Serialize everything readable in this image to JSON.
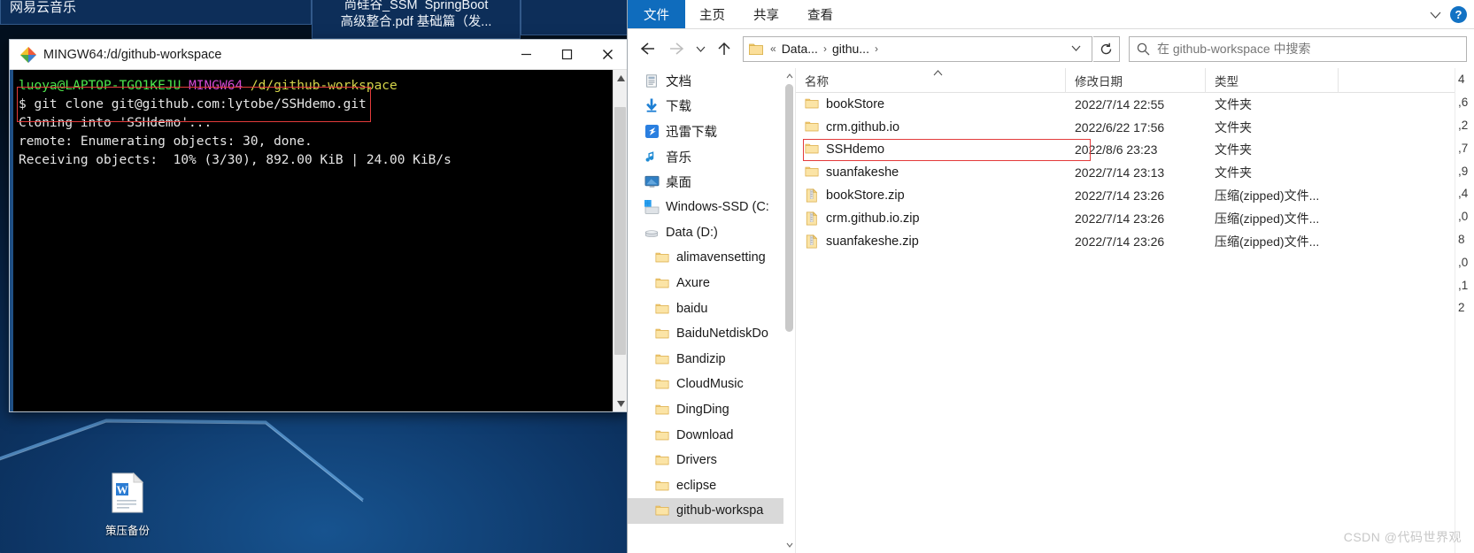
{
  "desktop": {
    "bg_windows": [
      {
        "name": "music-app-window",
        "title": "网易云音乐"
      },
      {
        "name": "pdf-reader-window",
        "title": "尚硅谷_SSM  SpringBoot\n高级整合.pdf 基础篇（发..."
      }
    ],
    "file_icon": {
      "label": "策压备份",
      "icon": "word-document-icon"
    }
  },
  "bash": {
    "title": "MINGW64:/d/github-workspace",
    "icon": "git-bash-icon",
    "minimize_label": "—",
    "maximize_label": "□",
    "close_label": "✕",
    "lines": [
      {
        "type": "prompt",
        "user": "luoya@LAPTOP-TGO1KEJU",
        "shell": "MINGW64",
        "path": "/d/github-workspace"
      },
      {
        "type": "command",
        "prefix": "$",
        "text": "git clone git@github.com:lytobe/SSHdemo.git"
      },
      {
        "type": "output",
        "text": "Cloning into 'SSHdemo'..."
      },
      {
        "type": "output",
        "text": "remote: Enumerating objects: 30, done."
      },
      {
        "type": "output",
        "text": "Receiving objects:  10% (3/30), 892.00 KiB | 24.00 KiB/s"
      }
    ],
    "highlight_color": "#e33b3b",
    "scroll_up": "▲",
    "scroll_down": "▼"
  },
  "explorer": {
    "tabs": [
      {
        "name": "tab-file",
        "label": "文件",
        "active": true
      },
      {
        "name": "tab-home",
        "label": "主页",
        "active": false
      },
      {
        "name": "tab-share",
        "label": "共享",
        "active": false
      },
      {
        "name": "tab-view",
        "label": "查看",
        "active": false
      }
    ],
    "ribbon_collapse_icon": "chevron-down-icon",
    "help_label": "?",
    "nav": {
      "back_icon": "arrow-left-icon",
      "forward_icon": "arrow-right-icon",
      "recent_icon": "chevron-down-icon",
      "up_icon": "arrow-up-icon",
      "refresh_icon": "refresh-icon",
      "breadcrumbs": [
        "«",
        "Data...",
        "githu..."
      ],
      "breadcrumb_dropdown_icon": "chevron-down-icon"
    },
    "search": {
      "icon": "search-icon",
      "placeholder": "在 github-workspace 中搜索",
      "value": ""
    },
    "sidebar": {
      "scroll_up": "∧",
      "scroll_down": "∨",
      "items": [
        {
          "label": "文档",
          "icon": "documents-icon",
          "indent": 1,
          "selected": false
        },
        {
          "label": "下载",
          "icon": "downloads-arrow-icon",
          "indent": 1,
          "selected": false
        },
        {
          "label": "迅雷下载",
          "icon": "thunder-download-icon",
          "indent": 1,
          "selected": false
        },
        {
          "label": "音乐",
          "icon": "music-note-icon",
          "indent": 1,
          "selected": false
        },
        {
          "label": "桌面",
          "icon": "desktop-monitor-icon",
          "indent": 1,
          "selected": false
        },
        {
          "label": "Windows-SSD (C:",
          "icon": "windows-drive-icon",
          "indent": 1,
          "selected": false
        },
        {
          "label": "Data (D:)",
          "icon": "drive-icon",
          "indent": 1,
          "selected": false
        },
        {
          "label": "alimavensetting",
          "icon": "folder-icon",
          "indent": 2,
          "selected": false
        },
        {
          "label": "Axure",
          "icon": "folder-icon",
          "indent": 2,
          "selected": false
        },
        {
          "label": "baidu",
          "icon": "folder-icon",
          "indent": 2,
          "selected": false
        },
        {
          "label": "BaiduNetdiskDo",
          "icon": "folder-icon",
          "indent": 2,
          "selected": false
        },
        {
          "label": "Bandizip",
          "icon": "folder-icon",
          "indent": 2,
          "selected": false
        },
        {
          "label": "CloudMusic",
          "icon": "folder-icon",
          "indent": 2,
          "selected": false
        },
        {
          "label": "DingDing",
          "icon": "folder-icon",
          "indent": 2,
          "selected": false
        },
        {
          "label": "Download",
          "icon": "folder-icon",
          "indent": 2,
          "selected": false
        },
        {
          "label": "Drivers",
          "icon": "folder-icon",
          "indent": 2,
          "selected": false
        },
        {
          "label": "eclipse",
          "icon": "folder-icon",
          "indent": 2,
          "selected": false
        },
        {
          "label": "github-workspa",
          "icon": "folder-icon",
          "indent": 2,
          "selected": true
        }
      ]
    },
    "columns": [
      {
        "key": "name",
        "label": "名称",
        "sorted": true,
        "sort_icon": "caret-up-icon"
      },
      {
        "key": "date",
        "label": "修改日期",
        "sorted": false
      },
      {
        "key": "type",
        "label": "类型",
        "sorted": false
      },
      {
        "key": "size",
        "label": "",
        "sorted": false
      }
    ],
    "rows": [
      {
        "name": "bookStore",
        "date": "2022/7/14 22:55",
        "type": "文件夹",
        "size": "",
        "icon": "folder-icon",
        "highlighted": false
      },
      {
        "name": "crm.github.io",
        "date": "2022/6/22 17:56",
        "type": "文件夹",
        "size": "",
        "icon": "folder-icon",
        "highlighted": false
      },
      {
        "name": "SSHdemo",
        "date": "2022/8/6 23:23",
        "type": "文件夹",
        "size": "",
        "icon": "folder-icon",
        "highlighted": true
      },
      {
        "name": "suanfakeshe",
        "date": "2022/7/14 23:13",
        "type": "文件夹",
        "size": "",
        "icon": "folder-icon",
        "highlighted": false
      },
      {
        "name": "bookStore.zip",
        "date": "2022/7/14 23:26",
        "type": "压缩(zipped)文件...",
        "size": "",
        "icon": "zip-file-icon",
        "highlighted": false
      },
      {
        "name": "crm.github.io.zip",
        "date": "2022/7/14 23:26",
        "type": "压缩(zipped)文件...",
        "size": "",
        "icon": "zip-file-icon",
        "highlighted": false
      },
      {
        "name": "suanfakeshe.zip",
        "date": "2022/7/14 23:26",
        "type": "压缩(zipped)文件...",
        "size": "",
        "icon": "zip-file-icon",
        "highlighted": false
      }
    ],
    "clipped_size_column": [
      "4",
      ",6",
      ",2",
      ",7",
      ",9",
      ",4",
      ",0",
      "8",
      ",0",
      ",1",
      "2"
    ]
  },
  "watermark": "CSDN @代码世界观",
  "colors": {
    "accent": "#0f6cbd",
    "highlight": "#e33b3b",
    "selection": "#d9d9d9",
    "terminal_bg": "#000000",
    "desktop_blue": "#0d3565"
  }
}
